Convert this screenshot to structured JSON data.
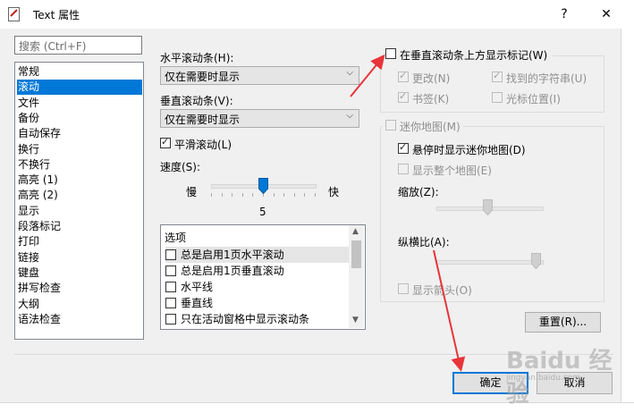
{
  "window": {
    "title": "Text 属性",
    "help_label": "?",
    "close_label": "✕"
  },
  "search": {
    "placeholder": "搜索 (Ctrl+F)"
  },
  "categories": {
    "items": [
      "常规",
      "滚动",
      "文件",
      "备份",
      "自动保存",
      "换行",
      "不换行",
      "高亮 (1)",
      "高亮 (2)",
      "显示",
      "段落标记",
      "打印",
      "链接",
      "键盘",
      "拼写检查",
      "大纲",
      "语法检查"
    ],
    "selected": "滚动"
  },
  "scroll": {
    "horizontal_label": "水平滚动条(H):",
    "horizontal_value": "仅在需要时显示",
    "vertical_label": "垂直滚动条(V):",
    "vertical_value": "仅在需要时显示",
    "smooth_label": "平滑滚动(L)",
    "smooth_checked": true,
    "speed_label": "速度(S):",
    "speed_slow": "慢",
    "speed_fast": "快",
    "speed_value": "5",
    "speed_max": 10
  },
  "options": {
    "header": "选项",
    "items": [
      {
        "label": "总是启用1页水平滚动",
        "checked": false
      },
      {
        "label": "总是启用1页垂直滚动",
        "checked": false
      },
      {
        "label": "水平线",
        "checked": false
      },
      {
        "label": "垂直线",
        "checked": false
      },
      {
        "label": "只在活动窗格中显示滚动条",
        "checked": false
      }
    ]
  },
  "markers": {
    "show_label": "在垂直滚动条上方显示标记(W)",
    "show_checked": false,
    "changes_label": "更改(N)",
    "found_label": "找到的字符串(U)",
    "bookmarks_label": "书签(K)",
    "cursor_label": "光标位置(I)"
  },
  "minimap": {
    "label": "迷你地图(M)",
    "hover_label": "悬停时显示迷你地图(D)",
    "hover_checked": true,
    "whole_label": "显示整个地图(E)",
    "zoom_label": "缩放(Z):",
    "ratio_label": "纵横比(A):",
    "arrow_label": "显示箭头(O)"
  },
  "buttons": {
    "reset": "重置(R)...",
    "ok": "确定",
    "cancel": "取消"
  },
  "watermark": {
    "text": "Baidu 经验",
    "subtext": "jingyan.baidu.com"
  },
  "colors": {
    "selection": "#0078d7",
    "annotation_arrow": "#e8353a"
  }
}
